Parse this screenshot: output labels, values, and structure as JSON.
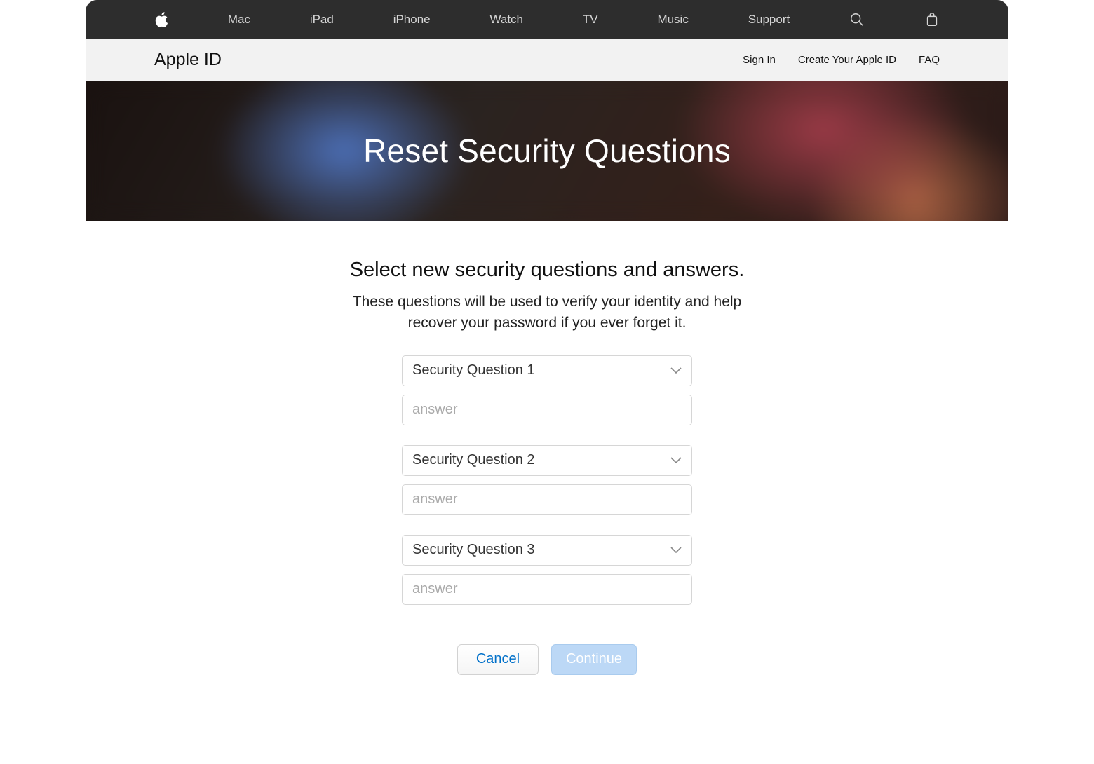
{
  "global_nav": {
    "items": [
      "Mac",
      "iPad",
      "iPhone",
      "Watch",
      "TV",
      "Music",
      "Support"
    ]
  },
  "sub_nav": {
    "title": "Apple ID",
    "links": [
      "Sign In",
      "Create Your Apple ID",
      "FAQ"
    ]
  },
  "hero": {
    "title": "Reset Security Questions"
  },
  "content": {
    "heading": "Select new security questions and answers.",
    "sub": "These questions will be used to verify your identity and help recover your password if you ever forget it."
  },
  "form": {
    "questions": [
      {
        "label": "Security Question 1",
        "placeholder": "answer",
        "value": ""
      },
      {
        "label": "Security Question 2",
        "placeholder": "answer",
        "value": ""
      },
      {
        "label": "Security Question 3",
        "placeholder": "answer",
        "value": ""
      }
    ]
  },
  "buttons": {
    "cancel": "Cancel",
    "continue": "Continue"
  }
}
